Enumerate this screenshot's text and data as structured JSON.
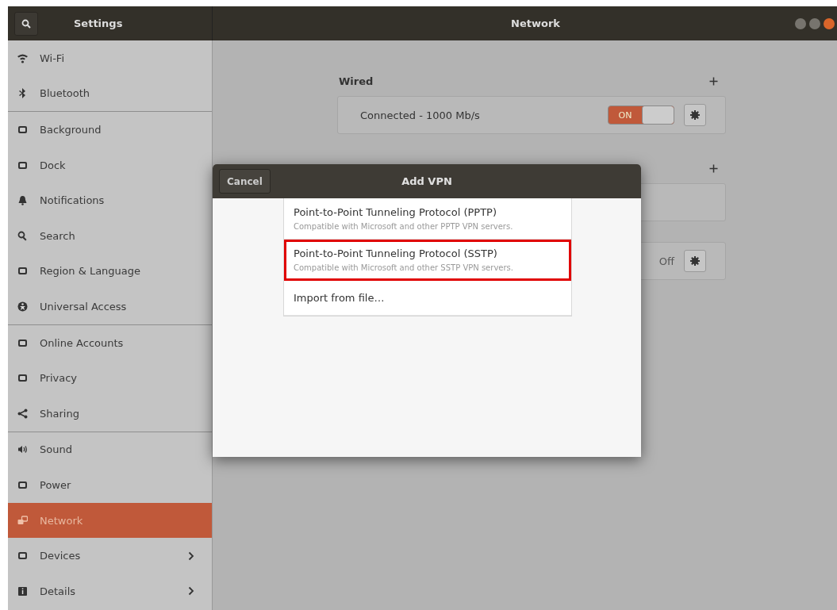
{
  "window": {
    "sidebar_title": "Settings",
    "title": "Network"
  },
  "sidebar": {
    "groups": [
      {
        "items": [
          {
            "label": "Wi-Fi",
            "selected": false,
            "expandable": false
          },
          {
            "label": "Bluetooth",
            "selected": false,
            "expandable": false
          }
        ]
      },
      {
        "items": [
          {
            "label": "Background",
            "selected": false,
            "expandable": false
          },
          {
            "label": "Dock",
            "selected": false,
            "expandable": false
          },
          {
            "label": "Notifications",
            "selected": false,
            "expandable": false
          },
          {
            "label": "Search",
            "selected": false,
            "expandable": false
          },
          {
            "label": "Region & Language",
            "selected": false,
            "expandable": false
          },
          {
            "label": "Universal Access",
            "selected": false,
            "expandable": false
          }
        ]
      },
      {
        "items": [
          {
            "label": "Online Accounts",
            "selected": false,
            "expandable": false
          },
          {
            "label": "Privacy",
            "selected": false,
            "expandable": false
          },
          {
            "label": "Sharing",
            "selected": false,
            "expandable": false
          }
        ]
      },
      {
        "items": [
          {
            "label": "Sound",
            "selected": false,
            "expandable": false
          },
          {
            "label": "Power",
            "selected": false,
            "expandable": false
          },
          {
            "label": "Network",
            "selected": true,
            "expandable": false
          },
          {
            "label": "Devices",
            "selected": false,
            "expandable": true
          },
          {
            "label": "Details",
            "selected": false,
            "expandable": true
          }
        ]
      }
    ]
  },
  "wired": {
    "heading": "Wired",
    "connection": {
      "status": "Connected - 1000 Mb/s",
      "on": true,
      "switch_label": "ON"
    }
  },
  "proxy": {
    "status": "Off"
  },
  "dialog": {
    "title": "Add VPN",
    "cancel": "Cancel",
    "options": [
      {
        "kind": "protocol",
        "title": "Point-to-Point Tunneling Protocol (PPTP)",
        "description": "Compatible with Microsoft and other PPTP VPN servers.",
        "selected": false
      },
      {
        "kind": "protocol",
        "title": "Point-to-Point Tunneling Protocol (SSTP)",
        "description": "Compatible with Microsoft and other SSTP VPN servers.",
        "selected": true
      },
      {
        "kind": "import",
        "title": "Import from file…",
        "selected": false
      }
    ]
  }
}
